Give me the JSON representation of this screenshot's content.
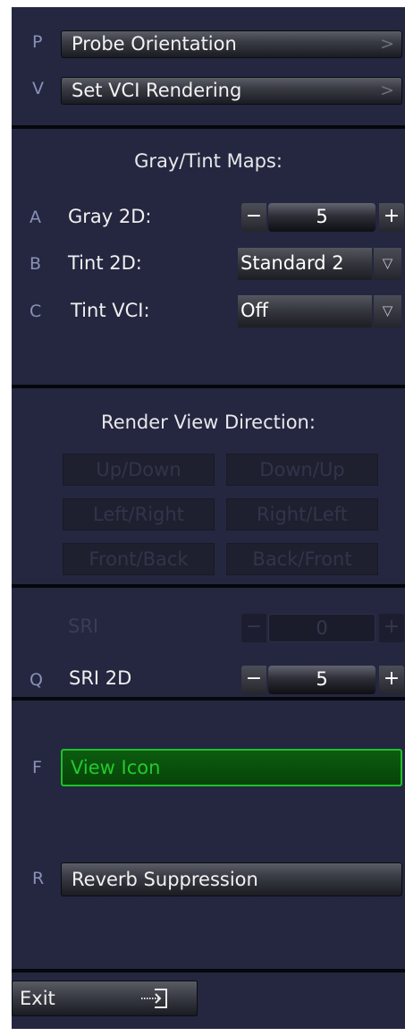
{
  "top": {
    "items": [
      {
        "key": "P",
        "label": "Probe Orientation",
        "chevron": ">"
      },
      {
        "key": "V",
        "label": "Set VCI Rendering",
        "chevron": ">"
      }
    ]
  },
  "maps": {
    "title": "Gray/Tint Maps:",
    "gray": {
      "key": "A",
      "label": "Gray 2D:",
      "value": "5",
      "minus": "−",
      "plus": "+"
    },
    "tint2d": {
      "key": "B",
      "label": "Tint 2D:",
      "value": "Standard 2",
      "arrow": "▽"
    },
    "tintvci": {
      "key": "C",
      "label": "Tint VCI:",
      "value": "Off",
      "arrow": "▽"
    }
  },
  "render": {
    "title": "Render View Direction:",
    "buttons": [
      "Up/Down",
      "Down/Up",
      "Left/Right",
      "Right/Left",
      "Front/Back",
      "Back/Front"
    ]
  },
  "sri": {
    "disabled": {
      "label": "SRI",
      "value": "0",
      "minus": "−",
      "plus": "+"
    },
    "active": {
      "key": "Q",
      "label": "SRI 2D",
      "value": "5",
      "minus": "−",
      "plus": "+"
    }
  },
  "bottom": {
    "view_icon": {
      "key": "F",
      "label": "View Icon",
      "state": "on"
    },
    "reverb": {
      "key": "R",
      "label": "Reverb Suppression"
    },
    "exit": {
      "label": "Exit",
      "icon": "exit-icon"
    }
  },
  "colors": {
    "panel_bg": "#24273f",
    "separator": "#06070d",
    "active_green": "#1fbf2c",
    "key_letter": "#8b90b8"
  }
}
